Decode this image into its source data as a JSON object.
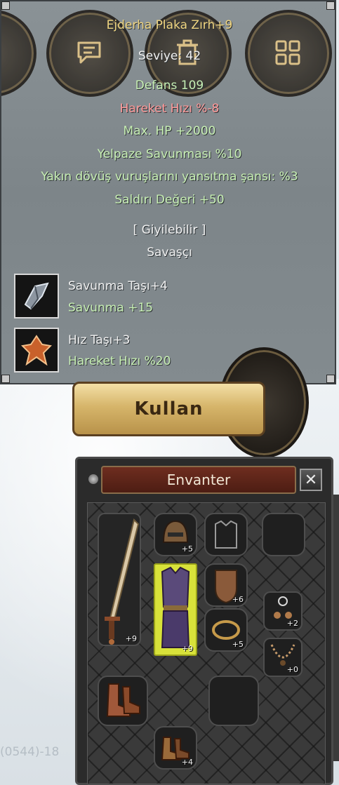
{
  "tooltip": {
    "item_name": "Ejderha Plaka Zırh+9",
    "level": "Seviye: 42",
    "defense": "Defans 109",
    "move_speed": "Hareket Hızı %-8",
    "max_hp": "Max. HP +2000",
    "fan_defense": "Yelpaze Savunması %10",
    "reflect": "Yakın dövüş vuruşlarını yansıtma şansı: %3",
    "attack_value": "Saldırı Değeri +50",
    "wearable": "[ Giyilebilir ]",
    "class": "Savaşçı",
    "stones": [
      {
        "name": "Savunma Taşı+4",
        "effect": "Savunma +15",
        "icon": "defense-stone-icon"
      },
      {
        "name": "Hız Taşı+3",
        "effect": "Hareket Hızı %20",
        "icon": "speed-stone-icon"
      }
    ]
  },
  "use_button": "Kullan",
  "background_text": "(0544)-18",
  "inventory": {
    "title": "Envanter",
    "close": "✕",
    "slots": {
      "helmet": "+5",
      "shield": "+6",
      "earring": "+2",
      "armor": "+9",
      "weapon": "+9",
      "bracelet": "+5",
      "necklace": "+0",
      "shoes": "+4"
    }
  },
  "colors": {
    "item_name": "#f0d580",
    "green_stat": "#c8f0b4",
    "red_stat": "#ff9a9a",
    "button_gold": "#d6b56a",
    "inventory_title_bg": "#6e2d1f"
  }
}
